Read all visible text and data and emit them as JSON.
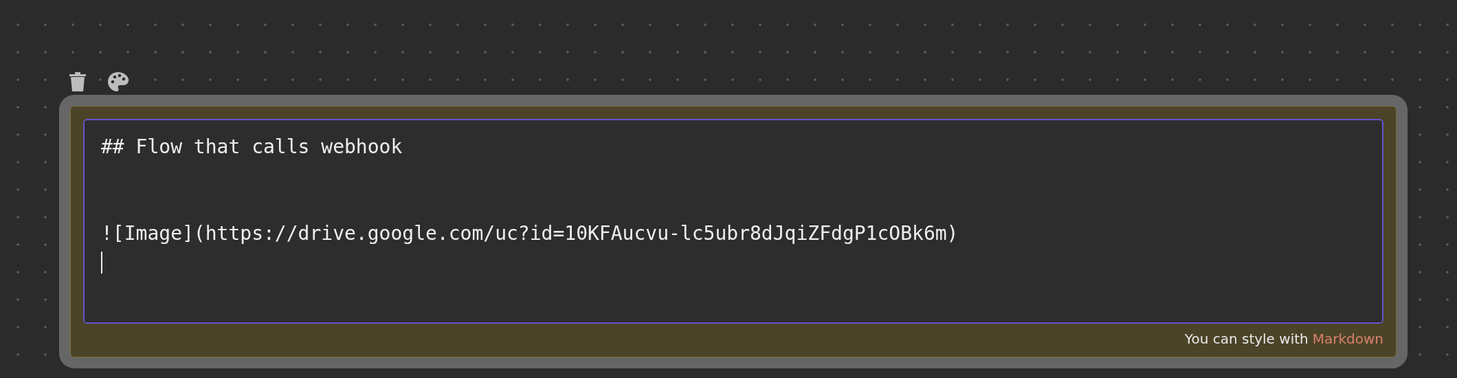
{
  "toolbar": {
    "buttons": [
      {
        "kind": "delete"
      },
      {
        "kind": "palette"
      }
    ]
  },
  "note": {
    "lines": [
      {
        "kind": "text",
        "text": "## Flow that calls webhook"
      },
      {
        "kind": "blank"
      },
      {
        "kind": "blank"
      },
      {
        "kind": "text",
        "text": "![Image](https://drive.google.com/uc?id=10KFAucvu-lc5ubr8dJqiZFdgP1cOBk6m)"
      },
      {
        "kind": "cursor"
      }
    ],
    "hint": "You can style with",
    "hint_link": "Markdown"
  }
}
